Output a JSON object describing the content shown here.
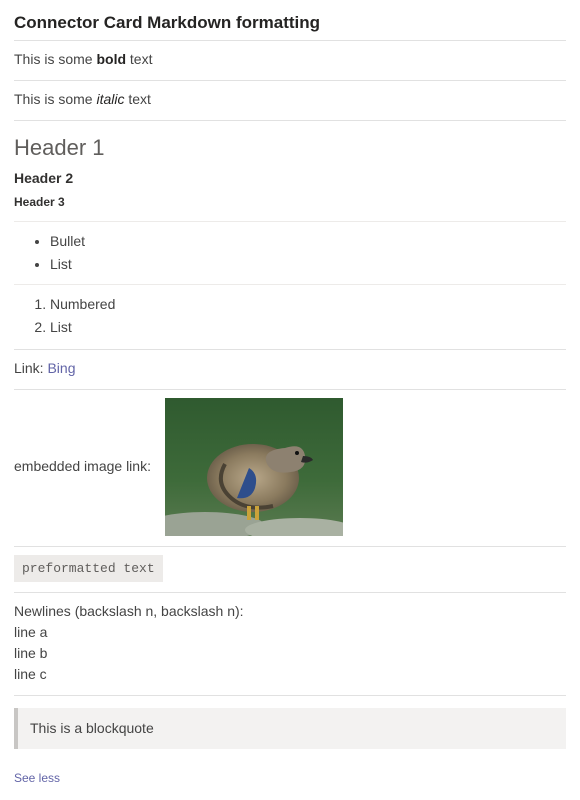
{
  "title": "Connector Card Markdown formatting",
  "bold_section": {
    "prefix": "This is some ",
    "bold": "bold",
    "suffix": " text"
  },
  "italic_section": {
    "prefix": "This is some ",
    "italic": "italic",
    "suffix": " text"
  },
  "headers": {
    "h1": "Header 1",
    "h2": "Header 2",
    "h3": "Header 3"
  },
  "bullets": [
    "Bullet",
    "List"
  ],
  "numbered": [
    "Numbered",
    "List"
  ],
  "link_row": {
    "label": "Link: ",
    "text": "Bing"
  },
  "image_row": {
    "label": "embedded image link:",
    "alt": "duck-image"
  },
  "preformatted": "preformatted text",
  "newlines": {
    "heading": "Newlines (backslash n, backslash n):",
    "lines": [
      "line a",
      "line b",
      "line c"
    ]
  },
  "blockquote": "This is a blockquote",
  "see_less": "See less"
}
